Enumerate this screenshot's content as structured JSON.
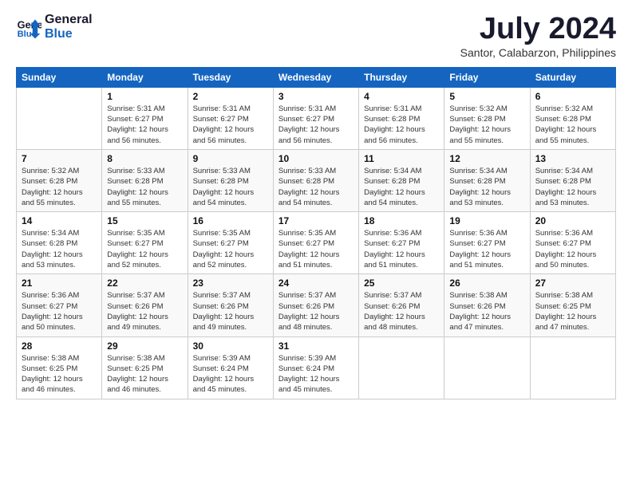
{
  "logo": {
    "line1": "General",
    "line2": "Blue"
  },
  "title": "July 2024",
  "subtitle": "Santor, Calabarzon, Philippines",
  "days_of_week": [
    "Sunday",
    "Monday",
    "Tuesday",
    "Wednesday",
    "Thursday",
    "Friday",
    "Saturday"
  ],
  "weeks": [
    [
      {
        "day": "",
        "info": ""
      },
      {
        "day": "1",
        "info": "Sunrise: 5:31 AM\nSunset: 6:27 PM\nDaylight: 12 hours\nand 56 minutes."
      },
      {
        "day": "2",
        "info": "Sunrise: 5:31 AM\nSunset: 6:27 PM\nDaylight: 12 hours\nand 56 minutes."
      },
      {
        "day": "3",
        "info": "Sunrise: 5:31 AM\nSunset: 6:27 PM\nDaylight: 12 hours\nand 56 minutes."
      },
      {
        "day": "4",
        "info": "Sunrise: 5:31 AM\nSunset: 6:28 PM\nDaylight: 12 hours\nand 56 minutes."
      },
      {
        "day": "5",
        "info": "Sunrise: 5:32 AM\nSunset: 6:28 PM\nDaylight: 12 hours\nand 55 minutes."
      },
      {
        "day": "6",
        "info": "Sunrise: 5:32 AM\nSunset: 6:28 PM\nDaylight: 12 hours\nand 55 minutes."
      }
    ],
    [
      {
        "day": "7",
        "info": "Sunrise: 5:32 AM\nSunset: 6:28 PM\nDaylight: 12 hours\nand 55 minutes."
      },
      {
        "day": "8",
        "info": "Sunrise: 5:33 AM\nSunset: 6:28 PM\nDaylight: 12 hours\nand 55 minutes."
      },
      {
        "day": "9",
        "info": "Sunrise: 5:33 AM\nSunset: 6:28 PM\nDaylight: 12 hours\nand 54 minutes."
      },
      {
        "day": "10",
        "info": "Sunrise: 5:33 AM\nSunset: 6:28 PM\nDaylight: 12 hours\nand 54 minutes."
      },
      {
        "day": "11",
        "info": "Sunrise: 5:34 AM\nSunset: 6:28 PM\nDaylight: 12 hours\nand 54 minutes."
      },
      {
        "day": "12",
        "info": "Sunrise: 5:34 AM\nSunset: 6:28 PM\nDaylight: 12 hours\nand 53 minutes."
      },
      {
        "day": "13",
        "info": "Sunrise: 5:34 AM\nSunset: 6:28 PM\nDaylight: 12 hours\nand 53 minutes."
      }
    ],
    [
      {
        "day": "14",
        "info": "Sunrise: 5:34 AM\nSunset: 6:28 PM\nDaylight: 12 hours\nand 53 minutes."
      },
      {
        "day": "15",
        "info": "Sunrise: 5:35 AM\nSunset: 6:27 PM\nDaylight: 12 hours\nand 52 minutes."
      },
      {
        "day": "16",
        "info": "Sunrise: 5:35 AM\nSunset: 6:27 PM\nDaylight: 12 hours\nand 52 minutes."
      },
      {
        "day": "17",
        "info": "Sunrise: 5:35 AM\nSunset: 6:27 PM\nDaylight: 12 hours\nand 51 minutes."
      },
      {
        "day": "18",
        "info": "Sunrise: 5:36 AM\nSunset: 6:27 PM\nDaylight: 12 hours\nand 51 minutes."
      },
      {
        "day": "19",
        "info": "Sunrise: 5:36 AM\nSunset: 6:27 PM\nDaylight: 12 hours\nand 51 minutes."
      },
      {
        "day": "20",
        "info": "Sunrise: 5:36 AM\nSunset: 6:27 PM\nDaylight: 12 hours\nand 50 minutes."
      }
    ],
    [
      {
        "day": "21",
        "info": "Sunrise: 5:36 AM\nSunset: 6:27 PM\nDaylight: 12 hours\nand 50 minutes."
      },
      {
        "day": "22",
        "info": "Sunrise: 5:37 AM\nSunset: 6:26 PM\nDaylight: 12 hours\nand 49 minutes."
      },
      {
        "day": "23",
        "info": "Sunrise: 5:37 AM\nSunset: 6:26 PM\nDaylight: 12 hours\nand 49 minutes."
      },
      {
        "day": "24",
        "info": "Sunrise: 5:37 AM\nSunset: 6:26 PM\nDaylight: 12 hours\nand 48 minutes."
      },
      {
        "day": "25",
        "info": "Sunrise: 5:37 AM\nSunset: 6:26 PM\nDaylight: 12 hours\nand 48 minutes."
      },
      {
        "day": "26",
        "info": "Sunrise: 5:38 AM\nSunset: 6:26 PM\nDaylight: 12 hours\nand 47 minutes."
      },
      {
        "day": "27",
        "info": "Sunrise: 5:38 AM\nSunset: 6:25 PM\nDaylight: 12 hours\nand 47 minutes."
      }
    ],
    [
      {
        "day": "28",
        "info": "Sunrise: 5:38 AM\nSunset: 6:25 PM\nDaylight: 12 hours\nand 46 minutes."
      },
      {
        "day": "29",
        "info": "Sunrise: 5:38 AM\nSunset: 6:25 PM\nDaylight: 12 hours\nand 46 minutes."
      },
      {
        "day": "30",
        "info": "Sunrise: 5:39 AM\nSunset: 6:24 PM\nDaylight: 12 hours\nand 45 minutes."
      },
      {
        "day": "31",
        "info": "Sunrise: 5:39 AM\nSunset: 6:24 PM\nDaylight: 12 hours\nand 45 minutes."
      },
      {
        "day": "",
        "info": ""
      },
      {
        "day": "",
        "info": ""
      },
      {
        "day": "",
        "info": ""
      }
    ]
  ]
}
